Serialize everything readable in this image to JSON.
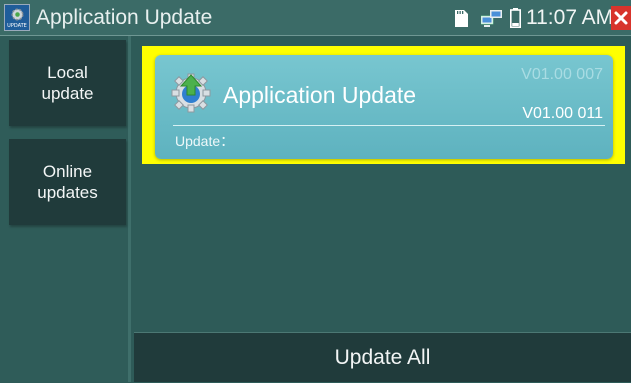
{
  "header": {
    "app_icon": "update-gear-icon",
    "app_icon_tag": "UPDATE",
    "title": "Application Update",
    "status_icons": [
      "sd-card-icon",
      "network-icon",
      "battery-icon"
    ],
    "time": "11:07 AM",
    "close_icon": "close-icon"
  },
  "sidebar": {
    "items": [
      {
        "label": "Local\nupdate"
      },
      {
        "label": "Online\nupdates"
      }
    ]
  },
  "main": {
    "card": {
      "icon": "update-gear-icon",
      "title": "Application Update",
      "current_version": "V01.00 007",
      "new_version": "V01.00 011",
      "update_label": "Update："
    },
    "update_all_label": "Update All"
  },
  "colors": {
    "highlight": "#ffff00",
    "card": "#6fbfcb",
    "dark_button": "#203b3b",
    "background": "#2e5b58"
  }
}
